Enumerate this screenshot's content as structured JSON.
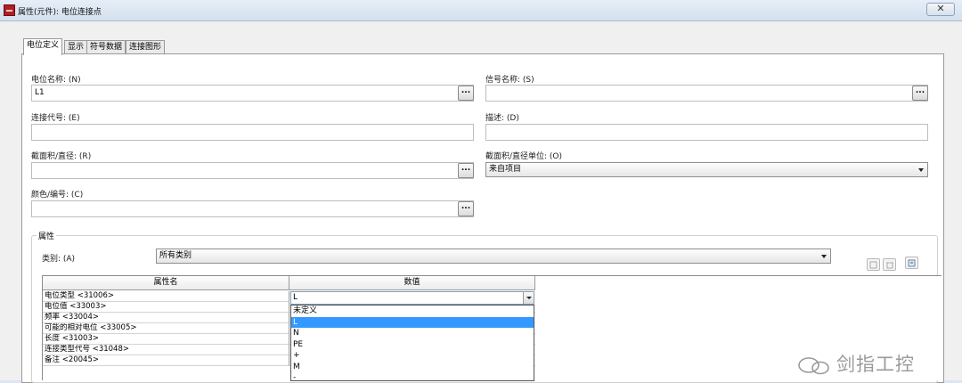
{
  "window": {
    "title": "属性(元件): 电位连接点",
    "close_label": "✕"
  },
  "tabs": [
    {
      "label": "电位定义",
      "active": true
    },
    {
      "label": "显示",
      "active": false
    },
    {
      "label": "符号数据",
      "active": false
    },
    {
      "label": "连接图形",
      "active": false
    }
  ],
  "form": {
    "potential_name": {
      "label": "电位名称: (N)",
      "value": "L1"
    },
    "signal_name": {
      "label": "信号名称: (S)",
      "value": ""
    },
    "connection_code": {
      "label": "连接代号: (E)",
      "value": ""
    },
    "description": {
      "label": "描述: (D)",
      "value": ""
    },
    "cross_section": {
      "label": "截面积/直径: (R)",
      "value": ""
    },
    "cross_section_unit": {
      "label": "截面积/直径单位: (O)",
      "value": "来自项目"
    },
    "color_number": {
      "label": "颜色/编号: (C)",
      "value": ""
    },
    "browse_label": "..."
  },
  "properties": {
    "group_title": "属性",
    "category_label": "类别: (A)",
    "category_value": "所有类别",
    "col_name": "属性名",
    "col_value": "数值",
    "rows": [
      {
        "name": "电位类型 <31006>"
      },
      {
        "name": "电位值 <33003>"
      },
      {
        "name": "频率 <33004>"
      },
      {
        "name": "可能的相对电位 <33005>"
      },
      {
        "name": "长度 <31003>"
      },
      {
        "name": "连接类型代号 <31048>"
      },
      {
        "name": "备注 <20045>"
      }
    ],
    "editing_value": "L",
    "dropdown_options": [
      "未定义",
      "L",
      "N",
      "PE",
      "+",
      "M",
      "-"
    ],
    "selected_option": "L"
  },
  "watermark": {
    "text": "剑指工控"
  }
}
